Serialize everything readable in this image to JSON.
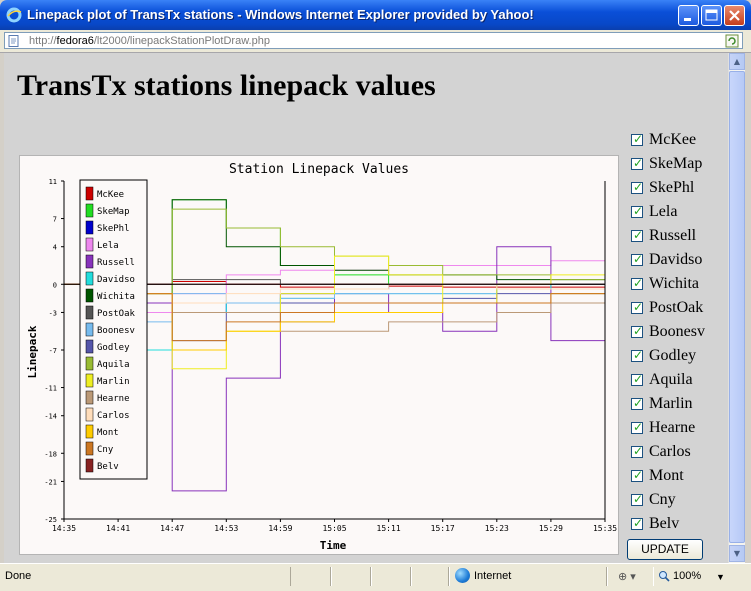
{
  "window": {
    "title": "Linepack plot of TransTx stations - Windows Internet Explorer provided by Yahoo!",
    "url_prefix": "http://",
    "url_host": "fedora6",
    "url_path": "/lt2000/linepackStationPlotDraw.php"
  },
  "page": {
    "heading": "TransTx stations linepack values"
  },
  "chart_data": {
    "type": "line",
    "title": "Station Linepack Values",
    "xlabel": "Time",
    "ylabel": "Linepack",
    "xticks": [
      "14:35",
      "14:41",
      "14:47",
      "14:53",
      "14:59",
      "15:05",
      "15:11",
      "15:17",
      "15:23",
      "15:29",
      "15:35"
    ],
    "yticks": [
      11,
      7,
      4,
      0,
      -3,
      -7,
      -11,
      -14,
      -18,
      -21,
      -25
    ],
    "ylim": [
      -25,
      11
    ],
    "legend_position": "top-left",
    "grid": false,
    "series": [
      {
        "name": "McKee",
        "color": "#cc0000",
        "values": [
          0,
          0,
          0.3,
          0,
          -0.3,
          0,
          -0.2,
          -0.3,
          -0.3,
          -0.3,
          -0.3
        ]
      },
      {
        "name": "SkeMap",
        "color": "#22dd22",
        "values": [
          0,
          -1,
          9,
          6,
          2,
          1,
          0,
          0,
          0,
          0,
          0
        ]
      },
      {
        "name": "SkePhl",
        "color": "#0000cc",
        "values": [
          0,
          -1,
          -3,
          -2,
          -1,
          -0.5,
          0,
          0,
          0,
          0,
          0
        ]
      },
      {
        "name": "Lela",
        "color": "#ee88ee",
        "values": [
          0,
          -3,
          -1,
          1,
          1.5,
          1.5,
          2,
          2,
          2,
          2.5,
          2.5
        ]
      },
      {
        "name": "Russell",
        "color": "#8833bb",
        "values": [
          0,
          -2,
          -22,
          -10,
          -4,
          -1,
          -3,
          -5,
          4,
          -6,
          -2
        ]
      },
      {
        "name": "Davidso",
        "color": "#22dddd",
        "values": [
          0,
          -7,
          -3,
          -2,
          -1.5,
          -1,
          -1,
          -1,
          -0.5,
          0,
          0.5
        ]
      },
      {
        "name": "Wichita",
        "color": "#005500",
        "values": [
          0,
          -1,
          9,
          4,
          2,
          1.5,
          1,
          1,
          0.5,
          0.5,
          0
        ]
      },
      {
        "name": "PostOak",
        "color": "#555555",
        "values": [
          0,
          0,
          0.5,
          0.5,
          0,
          0,
          0,
          0,
          0,
          0,
          -0.3
        ]
      },
      {
        "name": "Boonesv",
        "color": "#77bbee",
        "values": [
          0,
          -4,
          -1,
          -2,
          -1.5,
          -1,
          -1,
          -1,
          -0.5,
          -0.5,
          0
        ]
      },
      {
        "name": "Godley",
        "color": "#5555aa",
        "values": [
          0,
          -1,
          -6,
          -3,
          -2,
          -2,
          -2,
          -1.5,
          -1,
          -1,
          -0.5
        ]
      },
      {
        "name": "Aquila",
        "color": "#99bb33",
        "values": [
          0,
          -1,
          8,
          6,
          4,
          3,
          2,
          1,
          1,
          0.5,
          0.5
        ]
      },
      {
        "name": "Marlin",
        "color": "#eeee22",
        "values": [
          0,
          -1,
          -9,
          -5,
          -1,
          3,
          1,
          -2,
          0,
          1,
          1
        ]
      },
      {
        "name": "Hearne",
        "color": "#bb9977",
        "values": [
          0,
          -1,
          -3,
          -3,
          -5,
          -5,
          -4,
          -4,
          -3,
          -2,
          -3
        ]
      },
      {
        "name": "Carlos",
        "color": "#ffddbb",
        "values": [
          0,
          -1,
          -2,
          -1,
          -0.5,
          -0.5,
          0,
          0,
          -0.5,
          -0.5,
          -1
        ]
      },
      {
        "name": "Mont",
        "color": "#ffcc00",
        "values": [
          0,
          -1,
          -7,
          -5,
          -4,
          -3,
          -3,
          -2,
          -2,
          -1,
          -2
        ]
      },
      {
        "name": "Cny",
        "color": "#cc7722",
        "values": [
          0,
          -1,
          -6,
          -4,
          -3,
          -2,
          -2,
          -2,
          -2,
          -1,
          -1
        ]
      },
      {
        "name": "Belv",
        "color": "#882222",
        "values": [
          0,
          0,
          0,
          0,
          0,
          0,
          0,
          0,
          0,
          0,
          0
        ]
      }
    ]
  },
  "checkboxes": [
    {
      "label": "McKee",
      "checked": true
    },
    {
      "label": "SkeMap",
      "checked": true
    },
    {
      "label": "SkePhl",
      "checked": true
    },
    {
      "label": "Lela",
      "checked": true
    },
    {
      "label": "Russell",
      "checked": true
    },
    {
      "label": "Davidso",
      "checked": true
    },
    {
      "label": "Wichita",
      "checked": true
    },
    {
      "label": "PostOak",
      "checked": true
    },
    {
      "label": "Boonesv",
      "checked": true
    },
    {
      "label": "Godley",
      "checked": true
    },
    {
      "label": "Aquila",
      "checked": true
    },
    {
      "label": "Marlin",
      "checked": true
    },
    {
      "label": "Hearne",
      "checked": true
    },
    {
      "label": "Carlos",
      "checked": true
    },
    {
      "label": "Mont",
      "checked": true
    },
    {
      "label": "Cny",
      "checked": true
    },
    {
      "label": "Belv",
      "checked": true
    }
  ],
  "update_label": "UPDATE",
  "status": {
    "left": "Done",
    "zone": "Internet",
    "zoom": "100%"
  },
  "icons": {
    "app": "ie-icon",
    "minimize": "minimize-icon",
    "maximize": "maximize-icon",
    "close": "close-icon",
    "page": "page-icon",
    "go": "refresh-icon",
    "globe": "globe-icon",
    "zoom": "zoom-icon"
  }
}
